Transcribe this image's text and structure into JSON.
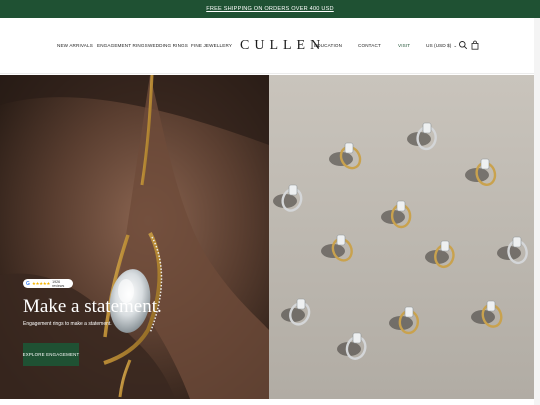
{
  "promo": {
    "text": "FREE SHIPPING ON ORDERS OVER 400 USD"
  },
  "nav": {
    "left": [
      "NEW ARRIVALS",
      "ENGAGEMENT RINGS",
      "WEDDING RINGS",
      "FINE JEWELLERY"
    ],
    "logo": "CULLEN",
    "right": [
      "EDUCATION",
      "CONTACT",
      "VISIT"
    ],
    "currency": "US (USD $)",
    "icons": [
      "search-icon",
      "bag-icon"
    ],
    "accent": "#1f5133"
  },
  "hero": {
    "rating": {
      "stars": "★★★★★",
      "count": "1926 reviews"
    },
    "title": "Make a statement.",
    "subtitle": "Engagement rings to make a statement.",
    "cta": "EXPLORE ENGAGEMENT"
  }
}
